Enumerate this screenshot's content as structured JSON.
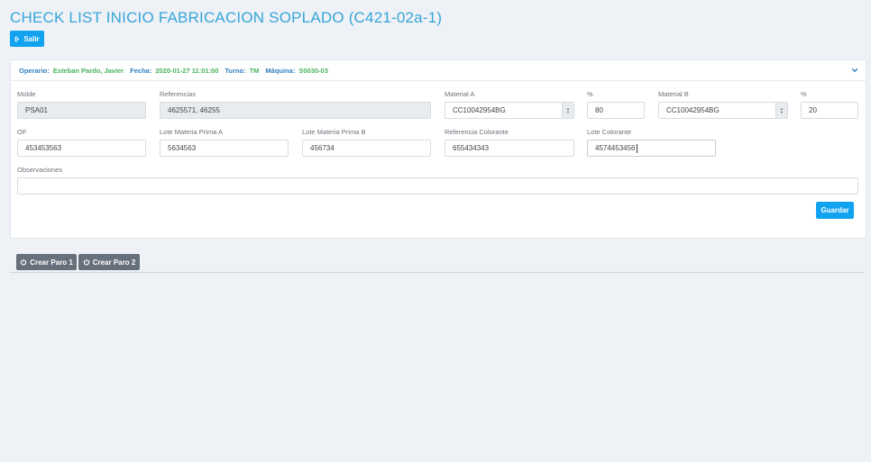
{
  "page": {
    "title": "CHECK LIST INICIO FABRICACION SOPLADO (C421-02a-1)",
    "salir_label": "Salir"
  },
  "header": {
    "operario_label": "Operario:",
    "operario_value": "Esteban Pardo, Javier",
    "fecha_label": "Fecha:",
    "fecha_value": "2020-01-27 11:01:00",
    "turno_label": "Turno:",
    "turno_value": "TM",
    "maquina_label": "Máquina:",
    "maquina_value": "S0030-03"
  },
  "form": {
    "molde": {
      "label": "Molde",
      "value": "PSA01"
    },
    "referencias": {
      "label": "Referencias",
      "value": "4625571, 46255"
    },
    "material_a": {
      "label": "Material A",
      "value": "CC10042954BG"
    },
    "pct_a": {
      "label": "%",
      "value": "80"
    },
    "material_b": {
      "label": "Material B",
      "value": "CC10042954BG"
    },
    "pct_b": {
      "label": "%",
      "value": "20"
    },
    "of": {
      "label": "OF",
      "value": "453453563"
    },
    "lote_mp_a": {
      "label": "Lote Materia Prima A",
      "value": "5634563"
    },
    "lote_mp_b": {
      "label": "Lote Materia Prima B",
      "value": "456734"
    },
    "ref_colorante": {
      "label": "Referencia Colorante",
      "value": "655434343"
    },
    "lote_colorante": {
      "label": "Lote Colorante",
      "value": "4574453456"
    },
    "observaciones": {
      "label": "Observaciones",
      "value": ""
    },
    "guardar_label": "Guardar"
  },
  "actions": {
    "paro1_label": "Crear Paro 1",
    "paro2_label": "Crear Paro 2"
  },
  "colors": {
    "accent_blue": "#12a3f0",
    "title_blue": "#35a6d9",
    "header_label": "#2f7fc0",
    "header_value": "#47b35a",
    "button_grey": "#66707a"
  }
}
